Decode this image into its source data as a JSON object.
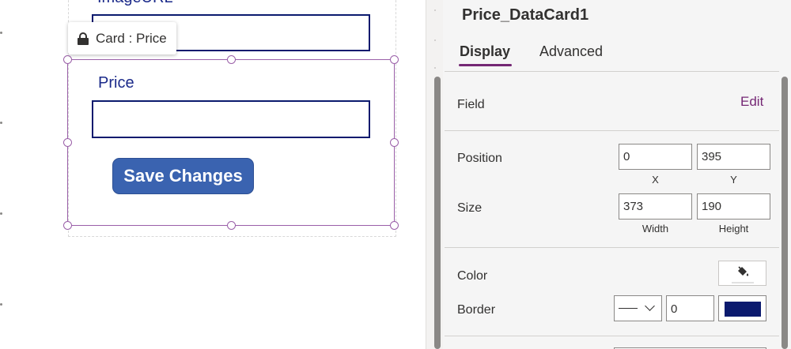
{
  "canvas": {
    "cut_label": "ImageURL",
    "tooltip_text": "Card : Price",
    "price_label": "Price",
    "save_button_label": "Save Changes"
  },
  "pane": {
    "title": "Price_DataCard1",
    "tabs": [
      {
        "label": "Display",
        "active": true
      },
      {
        "label": "Advanced",
        "active": false
      }
    ],
    "field": {
      "label": "Field",
      "action": "Edit"
    },
    "position": {
      "label": "Position",
      "x": "0",
      "y": "395",
      "x_caption": "X",
      "y_caption": "Y"
    },
    "size": {
      "label": "Size",
      "width": "373",
      "height": "190",
      "width_caption": "Width",
      "height_caption": "Height"
    },
    "color": {
      "label": "Color",
      "icon": "paint-bucket-icon"
    },
    "border": {
      "label": "Border",
      "style": "solid",
      "width": "0",
      "color": "#0b1a6e"
    }
  },
  "colors": {
    "accent": "#742774",
    "button": "#3a63b0",
    "field_border": "#0b1a6e",
    "selection": "#9a5fa8"
  }
}
